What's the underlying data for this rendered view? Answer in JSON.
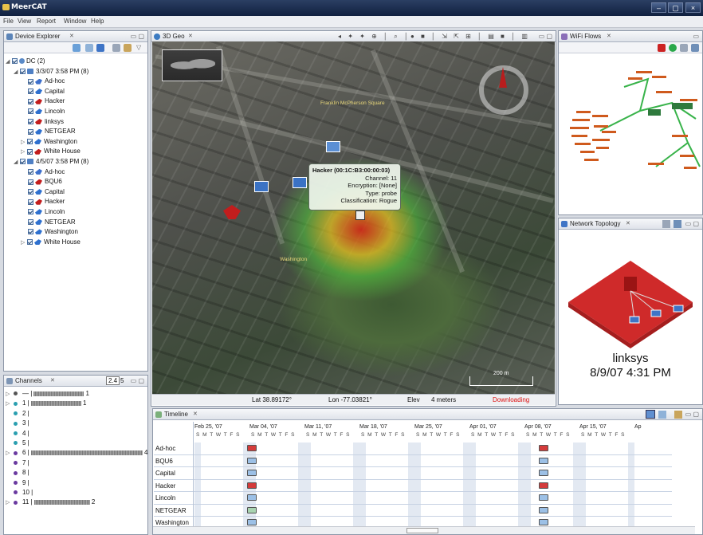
{
  "app": {
    "title": "MeerCAT"
  },
  "menu": [
    "File",
    "View",
    "Report",
    "Window",
    "Help"
  ],
  "device_explorer": {
    "title": "Device Explorer",
    "root": "DC (2)",
    "groups": [
      {
        "label": "3/3/07 3:58 PM (8)",
        "devices": [
          {
            "name": "Ad-hoc",
            "color": "#3c6fcc"
          },
          {
            "name": "Capital",
            "color": "#2e70cf"
          },
          {
            "name": "Hacker",
            "color": "#c21d1d"
          },
          {
            "name": "Lincoln",
            "color": "#2e70cf"
          },
          {
            "name": "linksys",
            "color": "#c21d1d"
          },
          {
            "name": "NETGEAR",
            "color": "#2e70cf"
          },
          {
            "name": "Washington",
            "color": "#2e70cf"
          },
          {
            "name": "White House",
            "color": "#c21d1d"
          }
        ]
      },
      {
        "label": "4/5/07 3:58 PM (8)",
        "devices": [
          {
            "name": "Ad-hoc",
            "color": "#3c6fcc"
          },
          {
            "name": "BQU6",
            "color": "#c21d1d"
          },
          {
            "name": "Capital",
            "color": "#2e70cf"
          },
          {
            "name": "Hacker",
            "color": "#c21d1d"
          },
          {
            "name": "Lincoln",
            "color": "#2e70cf"
          },
          {
            "name": "NETGEAR",
            "color": "#2e70cf"
          },
          {
            "name": "Washington",
            "color": "#2e70cf"
          },
          {
            "name": "White House",
            "color": "#2e70cf"
          }
        ]
      }
    ]
  },
  "channels": {
    "title": "Channels",
    "band_a": "2.4",
    "band_b": "5",
    "rows": [
      {
        "ch": "—",
        "count": "1",
        "bar": 0.45,
        "color": "#555"
      },
      {
        "ch": "1",
        "count": "1",
        "bar": 0.45,
        "color": "#2a9fb0"
      },
      {
        "ch": "2",
        "count": "",
        "bar": 0,
        "color": "#2a9fb0"
      },
      {
        "ch": "3",
        "count": "",
        "bar": 0,
        "color": "#2a9fb0"
      },
      {
        "ch": "4",
        "count": "",
        "bar": 0,
        "color": "#2a9fb0"
      },
      {
        "ch": "5",
        "count": "",
        "bar": 0,
        "color": "#2a9fb0"
      },
      {
        "ch": "6",
        "count": "4",
        "bar": 1.0,
        "color": "#6a3aa0"
      },
      {
        "ch": "7",
        "count": "",
        "bar": 0,
        "color": "#6a3aa0"
      },
      {
        "ch": "8",
        "count": "",
        "bar": 0,
        "color": "#6a3aa0"
      },
      {
        "ch": "9",
        "count": "",
        "bar": 0,
        "color": "#6a3aa0"
      },
      {
        "ch": "10",
        "count": "",
        "bar": 0,
        "color": "#6a3aa0"
      },
      {
        "ch": "11",
        "count": "2",
        "bar": 0.5,
        "color": "#6a3aa0"
      }
    ]
  },
  "geo": {
    "title": "3D Geo",
    "place_label_1": "Franklin McPherson Square",
    "place_label_2": "Washington",
    "scale": "200 m",
    "status": {
      "lat": "Lat 38.89172°",
      "lon": "Lon -77.03821°",
      "elev": "Elev",
      "elev_val": "4 meters",
      "state": "Downloading"
    },
    "popup": {
      "header": "Hacker (00:1C:B3:00:00:03)",
      "channel": "Channel: 11",
      "encryption": "Encryption: [None]",
      "type": "Type: probe",
      "classification": "Classification: Rogue"
    }
  },
  "wifi_flows": {
    "title": "WiFi Flows"
  },
  "network_topology": {
    "title": "Network Topology",
    "device": "linksys",
    "timestamp": "8/9/07 4:31 PM"
  },
  "timeline": {
    "title": "Timeline",
    "weeks": [
      "Feb 25, '07",
      "Mar 04, '07",
      "Mar 11, '07",
      "Mar 18, '07",
      "Mar 25, '07",
      "Apr 01, '07",
      "Apr 08, '07",
      "Apr 15, '07",
      "Ap"
    ],
    "days": "S M T W T F S",
    "rows": [
      "Ad-hoc",
      "BQU6",
      "Capital",
      "Hacker",
      "Lincoln",
      "NETGEAR",
      "Washington"
    ],
    "colors": {
      "red": "#d43b3b",
      "blue": "#9cc0e6",
      "green": "#a9d4b1"
    }
  }
}
